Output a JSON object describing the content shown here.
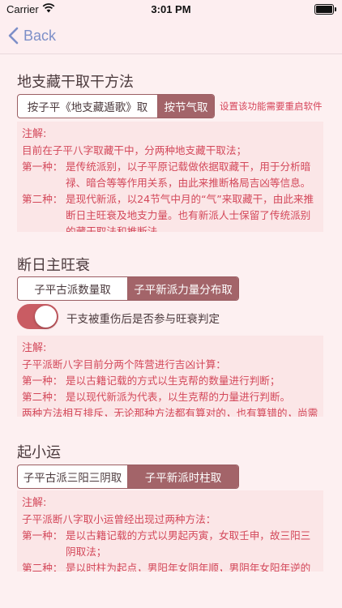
{
  "status_bar": {
    "carrier": "Carrier",
    "time": "3:01 PM"
  },
  "nav": {
    "back_label": "Back"
  },
  "branch": {
    "title": "地支藏干取干方法",
    "segments": [
      "按子平《地支藏遁歌》取",
      "按节气取"
    ],
    "selected_index": 1,
    "restart_note": "设置该功能需要重启软件",
    "note": {
      "title": "注解:",
      "intro": "目前在子平八字取藏干中，分两种地支藏干取法；",
      "items": [
        {
          "label": "第一种：",
          "text": "是传统派别，以子平原记载做依据取藏干，用于分析暗禄、暗合等等作用关系，由此来推断格局吉凶等信息。"
        },
        {
          "label": "第二种：",
          "text": "是现代新派，以24节气中月的“气”来取藏干，由此来推断日主旺衰及地支力量。也有新派人士保留了传统派别的藏干取法和推断法。"
        }
      ]
    }
  },
  "strength": {
    "title": "断日主旺衰",
    "segments": [
      "子平古派数量取",
      "子平新派力量分布取"
    ],
    "selected_index": 1,
    "toggle_label": "干支被重伤后是否参与旺衰判定",
    "toggle_on": true,
    "note": {
      "title": "注解:",
      "intro": "子平派断八字目前分两个阵营进行吉凶计算：",
      "items": [
        {
          "label": "第一种：",
          "text": "是以古籍记载的方式以生克帮的数量进行判断；"
        },
        {
          "label": "第二种：",
          "text": "是以现代新派为代表，以生克帮的力量进行判断。"
        }
      ],
      "outro": "两种方法相互排斥，无论那种方法都有算对的，也有算错的，尚需结合实际情况。"
    }
  },
  "minor_luck": {
    "title": "起小运",
    "segments": [
      "子平古派三阳三阴取",
      "子平新派时柱取"
    ],
    "selected_index": 1,
    "note": {
      "title": "注解:",
      "intro": "子平派断八字取小运曾经出现过两种方法：",
      "items": [
        {
          "label": "第一种：",
          "text": "是以古籍记载的方式以男起丙寅，女取壬申，故三阳三阴取法；"
        },
        {
          "label": "第二种：",
          "text": "是以时柱为起点，男阳年女阴年顺，男阴年女阳年逆的方式。"
        }
      ]
    }
  },
  "colors": {
    "accent": "#a36469",
    "note_text": "#d3485a",
    "note_bg": "#fbe6e7",
    "back": "#7d8fc8"
  }
}
